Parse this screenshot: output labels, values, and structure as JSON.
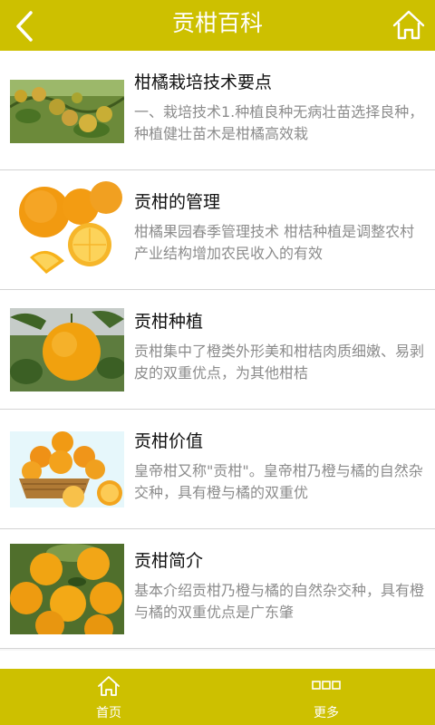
{
  "header": {
    "title": "贡柑百科"
  },
  "articles": [
    {
      "title": "柑橘栽培技术要点",
      "summary": "一、栽培技术1.种植良种无病壮苗选择良种，种植健壮苗木是柑橘高效栽"
    },
    {
      "title": "贡柑的管理",
      "summary": "柑橘果园春季管理技术 柑桔种植是调整农村产业结构增加农民收入的有效"
    },
    {
      "title": "贡柑种植",
      "summary": "贡柑集中了橙类外形美和柑桔肉质细嫩、易剥皮的双重优点，为其他柑桔"
    },
    {
      "title": "贡柑价值",
      "summary": "皇帝柑又称\"贡柑\"。皇帝柑乃橙与橘的自然杂交种，具有橙与橘的双重优"
    },
    {
      "title": "贡柑简介",
      "summary": "基本介绍贡柑乃橙与橘的自然杂交种，具有橙与橘的双重优点是广东肇"
    }
  ],
  "tabbar": {
    "home_label": "首页",
    "more_label": "更多"
  },
  "colors": {
    "accent": "#cdc000"
  },
  "icons": {
    "back": "chevron-left-icon",
    "home": "home-icon",
    "tab_home": "home-icon",
    "tab_more": "more-dots-icon"
  }
}
